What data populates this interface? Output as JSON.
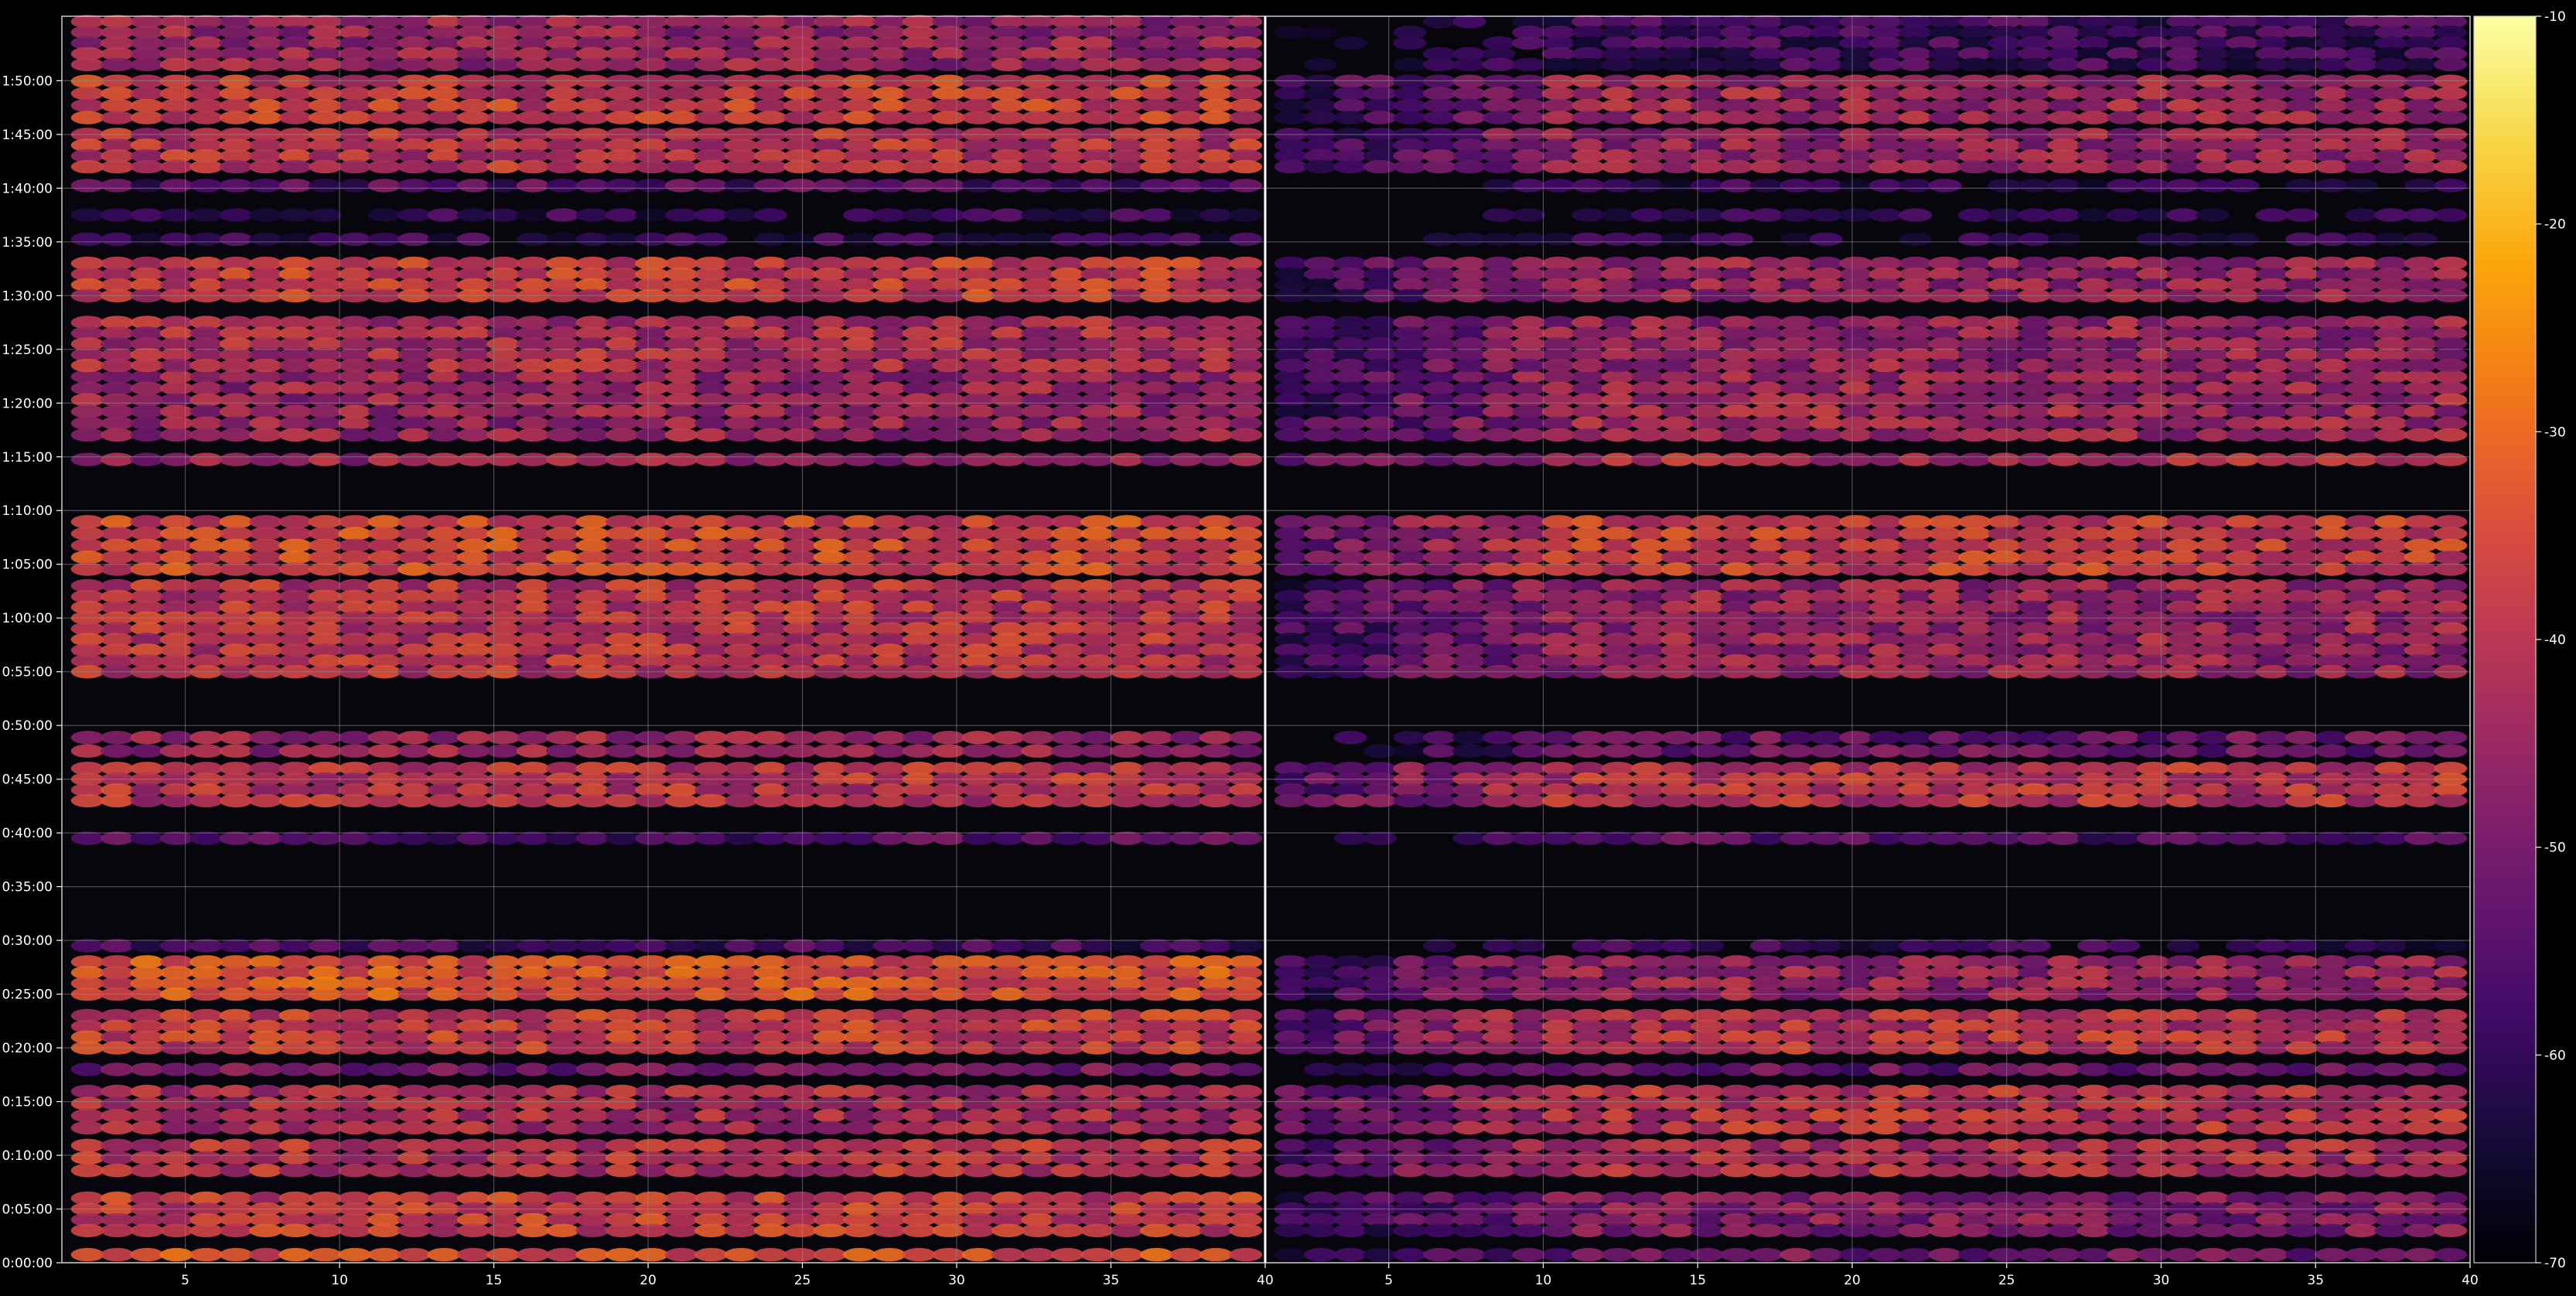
{
  "chart_data": {
    "type": "heatmap",
    "title": "",
    "xlabel": "",
    "ylabel": "",
    "panels": [
      {
        "xlim": [
          1,
          40
        ],
        "xticks": [
          5,
          10,
          15,
          20,
          25,
          30,
          35,
          40
        ]
      },
      {
        "xlim": [
          1,
          40
        ],
        "xticks": [
          5,
          10,
          15,
          20,
          25,
          30,
          35,
          40
        ]
      }
    ],
    "y_range_seconds": [
      0,
      6960
    ],
    "yticks": [
      "0:00:00",
      "0:05:00",
      "0:10:00",
      "0:15:00",
      "0:20:00",
      "0:25:00",
      "0:30:00",
      "0:35:00",
      "0:40:00",
      "0:45:00",
      "0:50:00",
      "0:55:00",
      "1:00:00",
      "1:05:00",
      "1:10:00",
      "1:15:00",
      "1:20:00",
      "1:25:00",
      "1:30:00",
      "1:35:00",
      "1:40:00",
      "1:45:00",
      "1:50:00"
    ],
    "grid": true,
    "colorbar": {
      "range": [
        -70,
        -10
      ],
      "ticks": [
        "-10",
        "-20",
        "-30",
        "-40",
        "-50",
        "-60",
        "-70"
      ],
      "colormap": "inferno"
    },
    "bands": [
      {
        "time_start": "0:00:00",
        "time_end": "0:01:30",
        "left_level": -35,
        "right_level": -50
      },
      {
        "time_start": "0:02:30",
        "time_end": "0:06:30",
        "left_level": -38,
        "right_level": -48
      },
      {
        "time_start": "0:08:00",
        "time_end": "0:11:30",
        "left_level": -40,
        "right_level": -42
      },
      {
        "time_start": "0:12:00",
        "time_end": "0:16:30",
        "left_level": -42,
        "right_level": -40
      },
      {
        "time_start": "0:17:30",
        "time_end": "0:18:30",
        "left_level": -50,
        "right_level": -52
      },
      {
        "time_start": "0:19:30",
        "time_end": "0:23:30",
        "left_level": -38,
        "right_level": -40
      },
      {
        "time_start": "0:24:30",
        "time_end": "0:28:30",
        "left_level": -34,
        "right_level": -45
      },
      {
        "time_start": "0:29:00",
        "time_end": "0:30:00",
        "left_level": -58,
        "right_level": -60
      },
      {
        "time_start": "0:39:00",
        "time_end": "0:40:00",
        "left_level": -55,
        "right_level": -55
      },
      {
        "time_start": "0:42:30",
        "time_end": "0:46:30",
        "left_level": -40,
        "right_level": -40
      },
      {
        "time_start": "0:47:00",
        "time_end": "0:49:30",
        "left_level": -45,
        "right_level": -52
      },
      {
        "time_start": "0:54:30",
        "time_end": "1:03:30",
        "left_level": -40,
        "right_level": -45
      },
      {
        "time_start": "1:04:00",
        "time_end": "1:09:30",
        "left_level": -36,
        "right_level": -38
      },
      {
        "time_start": "1:14:00",
        "time_end": "1:15:30",
        "left_level": -45,
        "right_level": -42
      },
      {
        "time_start": "1:16:30",
        "time_end": "1:23:00",
        "left_level": -45,
        "right_level": -44
      },
      {
        "time_start": "1:23:00",
        "time_end": "1:28:00",
        "left_level": -42,
        "right_level": -45
      },
      {
        "time_start": "1:29:30",
        "time_end": "1:33:30",
        "left_level": -38,
        "right_level": -45
      },
      {
        "time_start": "1:34:30",
        "time_end": "1:36:00",
        "left_level": -60,
        "right_level": -62
      },
      {
        "time_start": "1:37:00",
        "time_end": "1:38:00",
        "left_level": -60,
        "right_level": -62
      },
      {
        "time_start": "1:40:00",
        "time_end": "1:40:30",
        "left_level": -55,
        "right_level": -60
      },
      {
        "time_start": "1:41:30",
        "time_end": "1:45:30",
        "left_level": -40,
        "right_level": -45
      },
      {
        "time_start": "1:46:00",
        "time_end": "1:50:30",
        "left_level": -38,
        "right_level": -44
      },
      {
        "time_start": "1:51:00",
        "time_end": "1:56:00",
        "left_level": -45,
        "right_level": -58
      }
    ],
    "colors": {
      "background": "#000000",
      "grid": "#8c8c8c",
      "text": "#ffffff"
    }
  }
}
